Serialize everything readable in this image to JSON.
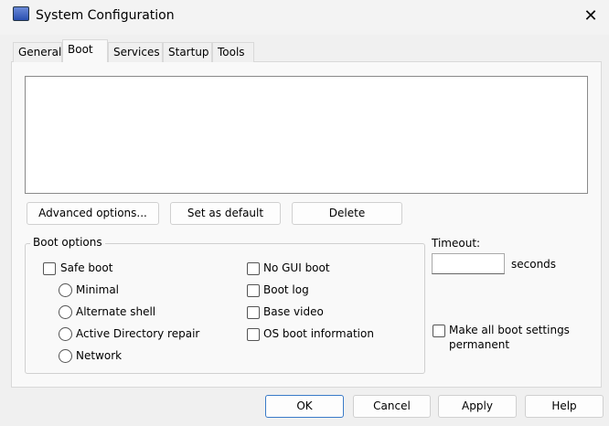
{
  "window": {
    "title": "System Configuration",
    "close_icon": "close-icon"
  },
  "tabs": [
    {
      "label": "General"
    },
    {
      "label": "Boot",
      "selected": true
    },
    {
      "label": "Services"
    },
    {
      "label": "Startup"
    },
    {
      "label": "Tools"
    }
  ],
  "boot": {
    "entries": [],
    "buttons": {
      "advanced": "Advanced options...",
      "set_default": "Set as default",
      "delete": "Delete"
    },
    "boot_options": {
      "title": "Boot options",
      "safe_boot": {
        "label": "Safe boot",
        "checked": false
      },
      "radios": [
        {
          "label": "Minimal"
        },
        {
          "label": "Alternate shell"
        },
        {
          "label": "Active Directory repair"
        },
        {
          "label": "Network"
        }
      ],
      "right": [
        {
          "label": "No GUI boot"
        },
        {
          "label": "Boot log"
        },
        {
          "label": "Base video"
        },
        {
          "label": "OS boot information"
        }
      ]
    },
    "timeout": {
      "label": "Timeout:",
      "value": "",
      "unit": "seconds"
    },
    "permanent": {
      "label_line1": "Make all boot settings",
      "label_line2": "permanent",
      "checked": false
    }
  },
  "footer": {
    "ok": "OK",
    "cancel": "Cancel",
    "apply": "Apply",
    "help": "Help"
  }
}
